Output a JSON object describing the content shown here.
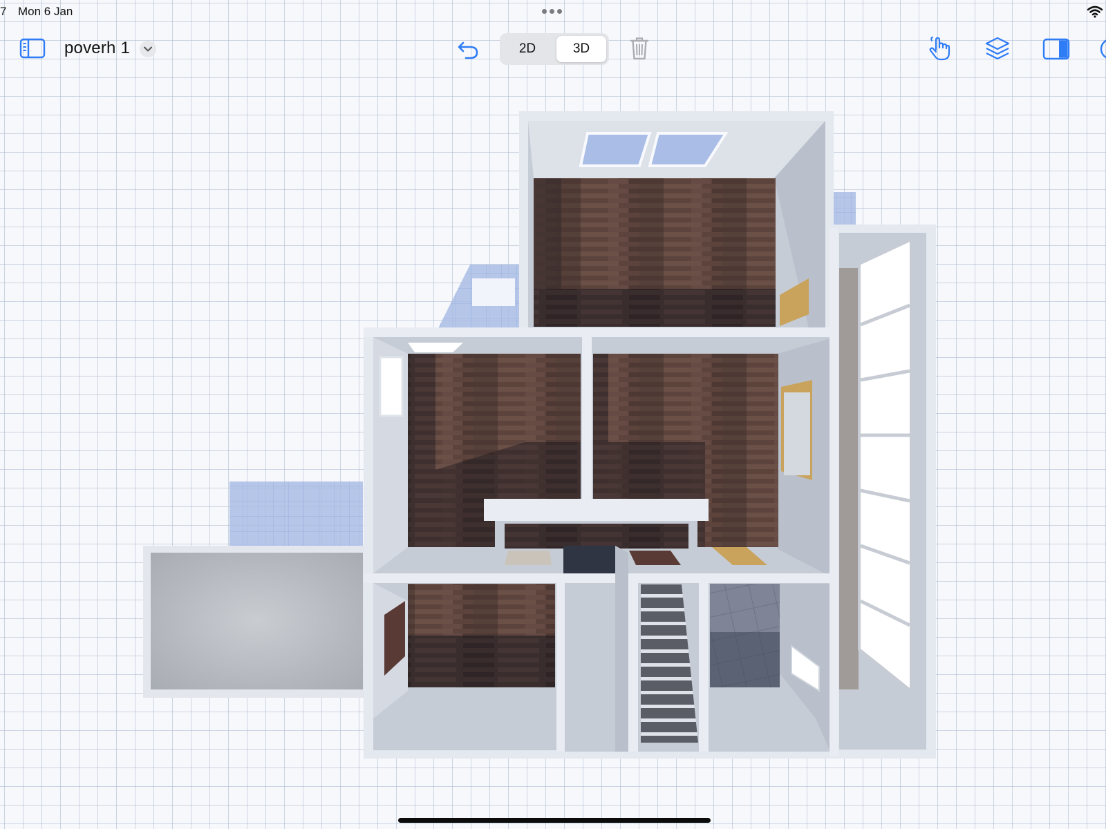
{
  "status": {
    "time": "7",
    "date": "Mon 6 Jan"
  },
  "toolbar": {
    "title": "poverh 1",
    "view_modes": [
      {
        "label": "2D",
        "selected": false
      },
      {
        "label": "3D",
        "selected": true
      }
    ],
    "accent_color": "#2e7cf6",
    "icons": [
      "sidebar-icon",
      "chevron-down-icon",
      "undo-icon",
      "trash-icon",
      "hand-pointer-icon",
      "layers-icon",
      "side-panel-icon"
    ]
  },
  "scene": {
    "description_type": "3d-floor-plan",
    "floor_color": "#5a4039",
    "wall_color": "#cfd5de"
  }
}
